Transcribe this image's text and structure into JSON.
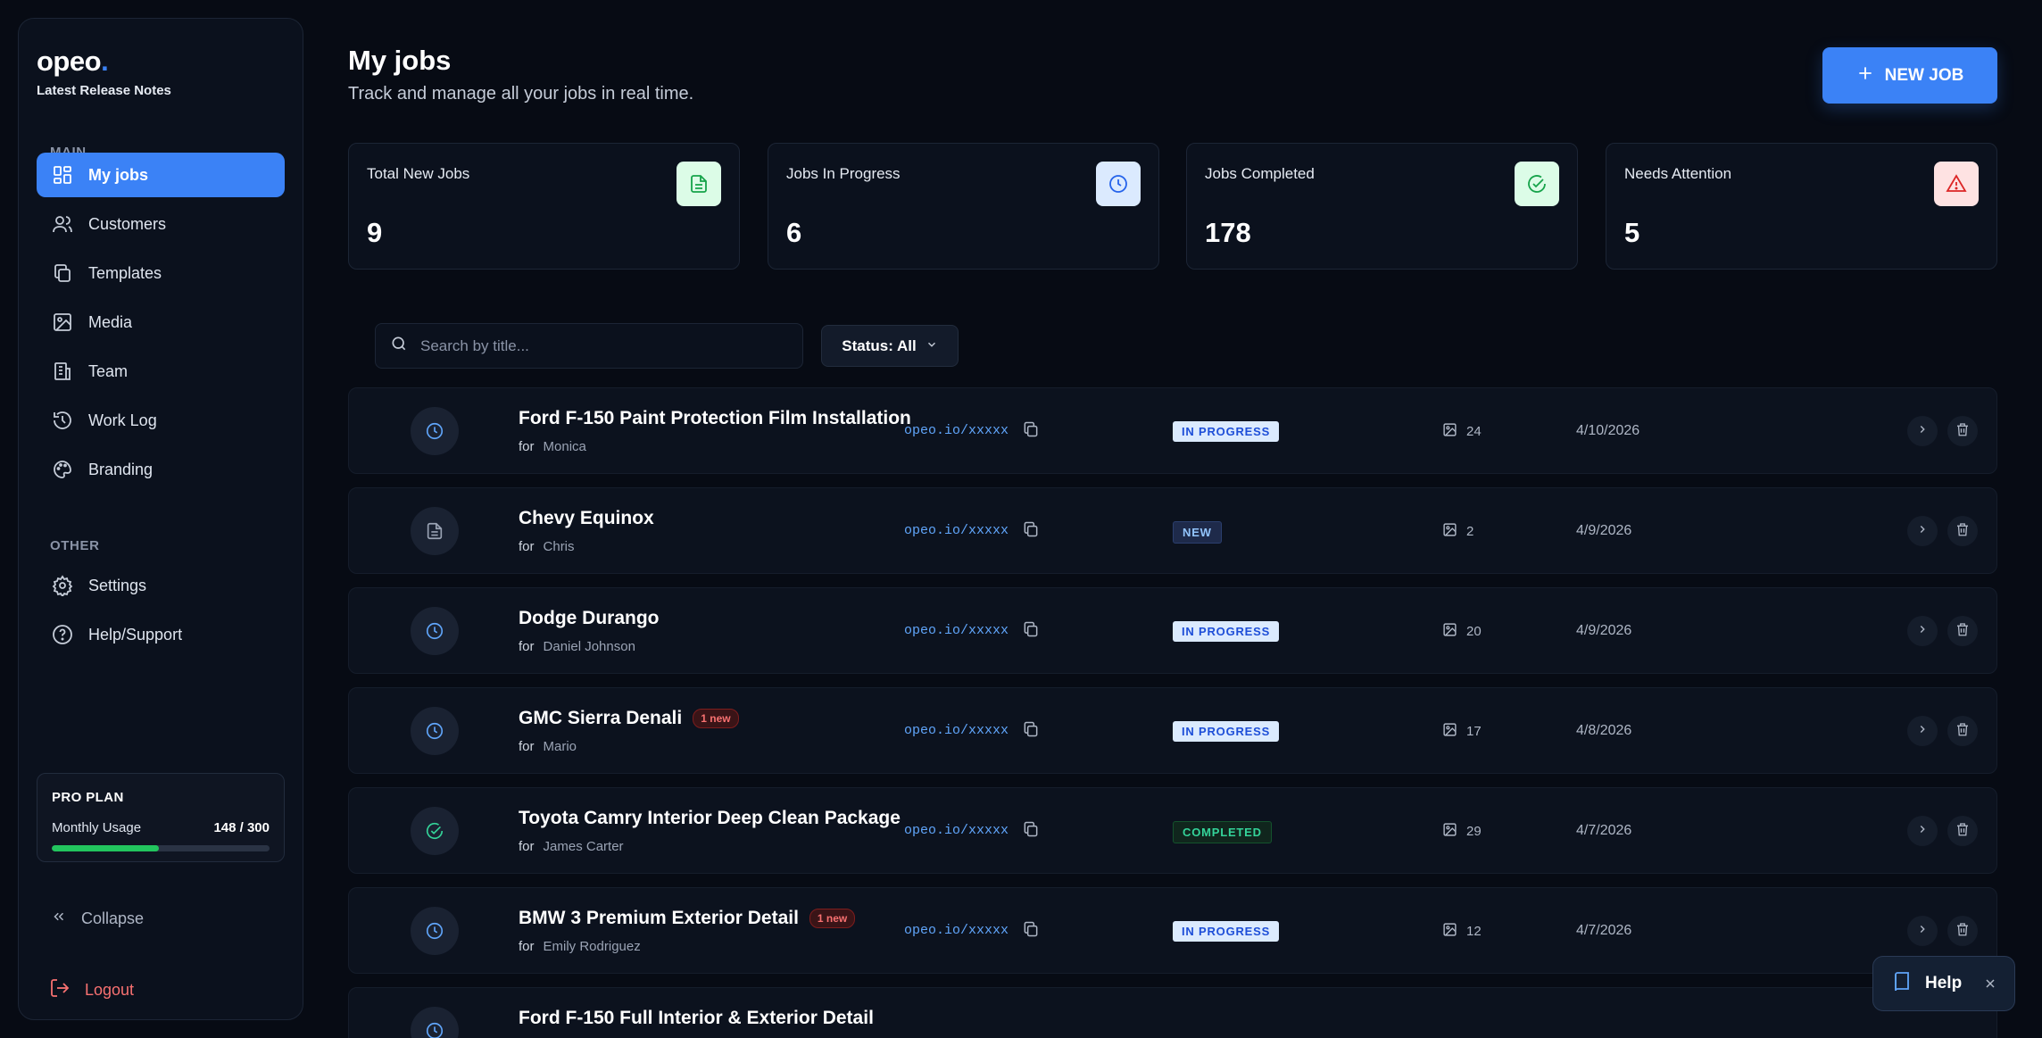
{
  "sidebar": {
    "logo": "opeo",
    "logo_dot": ".",
    "release_notes": "Latest Release Notes",
    "main_label": "MAIN",
    "other_label": "OTHER",
    "items": [
      {
        "label": "My jobs",
        "icon": "grid-icon",
        "active": true
      },
      {
        "label": "Customers",
        "icon": "users-icon"
      },
      {
        "label": "Templates",
        "icon": "copy-icon"
      },
      {
        "label": "Media",
        "icon": "image-icon"
      },
      {
        "label": "Team",
        "icon": "building-icon"
      },
      {
        "label": "Work Log",
        "icon": "history-icon"
      },
      {
        "label": "Branding",
        "icon": "palette-icon"
      },
      {
        "label": "Settings",
        "icon": "gear-icon"
      },
      {
        "label": "Help/Support",
        "icon": "help-circle-icon"
      }
    ],
    "plan": {
      "title": "PRO PLAN",
      "usage_label": "Monthly Usage",
      "usage_value": "148 / 300",
      "used": 148,
      "limit": 300
    },
    "collapse": "Collapse",
    "logout": "Logout"
  },
  "header": {
    "title": "My jobs",
    "subtitle": "Track and manage all your jobs in real time.",
    "new_job": "NEW JOB"
  },
  "stats": [
    {
      "label": "Total New Jobs",
      "value": "9",
      "icon": "document-icon",
      "color": "#16a34a"
    },
    {
      "label": "Jobs In Progress",
      "value": "6",
      "icon": "clock-icon",
      "color": "#2563eb"
    },
    {
      "label": "Jobs Completed",
      "value": "178",
      "icon": "check-circle-icon",
      "color": "#16a34a"
    },
    {
      "label": "Needs Attention",
      "value": "5",
      "icon": "warning-icon",
      "color": "#dc2626"
    }
  ],
  "filters": {
    "search_placeholder": "Search by title...",
    "status": "Status: All"
  },
  "jobs": [
    {
      "title": "Ford F-150 Paint Protection Film Installation",
      "for_label": "for",
      "customer": "Monica",
      "link": "opeo.io/xxxxx",
      "status": "IN PROGRESS",
      "media": "24",
      "date": "4/10/2026",
      "badge": ""
    },
    {
      "title": "Chevy Equinox",
      "for_label": "for",
      "customer": "Chris",
      "link": "opeo.io/xxxxx",
      "status": "NEW",
      "media": "2",
      "date": "4/9/2026",
      "badge": ""
    },
    {
      "title": "Dodge Durango",
      "for_label": "for",
      "customer": "Daniel Johnson",
      "link": "opeo.io/xxxxx",
      "status": "IN PROGRESS",
      "media": "20",
      "date": "4/9/2026",
      "badge": ""
    },
    {
      "title": "GMC Sierra Denali",
      "for_label": "for",
      "customer": "Mario",
      "link": "opeo.io/xxxxx",
      "status": "IN PROGRESS",
      "media": "17",
      "date": "4/8/2026",
      "badge": "1 new"
    },
    {
      "title": "Toyota Camry Interior Deep Clean Package",
      "for_label": "for",
      "customer": "James Carter",
      "link": "opeo.io/xxxxx",
      "status": "COMPLETED",
      "media": "29",
      "date": "4/7/2026",
      "badge": ""
    },
    {
      "title": "BMW 3 Premium Exterior Detail",
      "for_label": "for",
      "customer": "Emily Rodriguez",
      "link": "opeo.io/xxxxx",
      "status": "IN PROGRESS",
      "media": "12",
      "date": "4/7/2026",
      "badge": "1 new"
    },
    {
      "title": "Ford F-150 Full Interior & Exterior Detail",
      "for_label": "for",
      "customer": "",
      "link": "",
      "status": "",
      "media": "",
      "date": "",
      "badge": ""
    }
  ],
  "help": {
    "label": "Help"
  }
}
